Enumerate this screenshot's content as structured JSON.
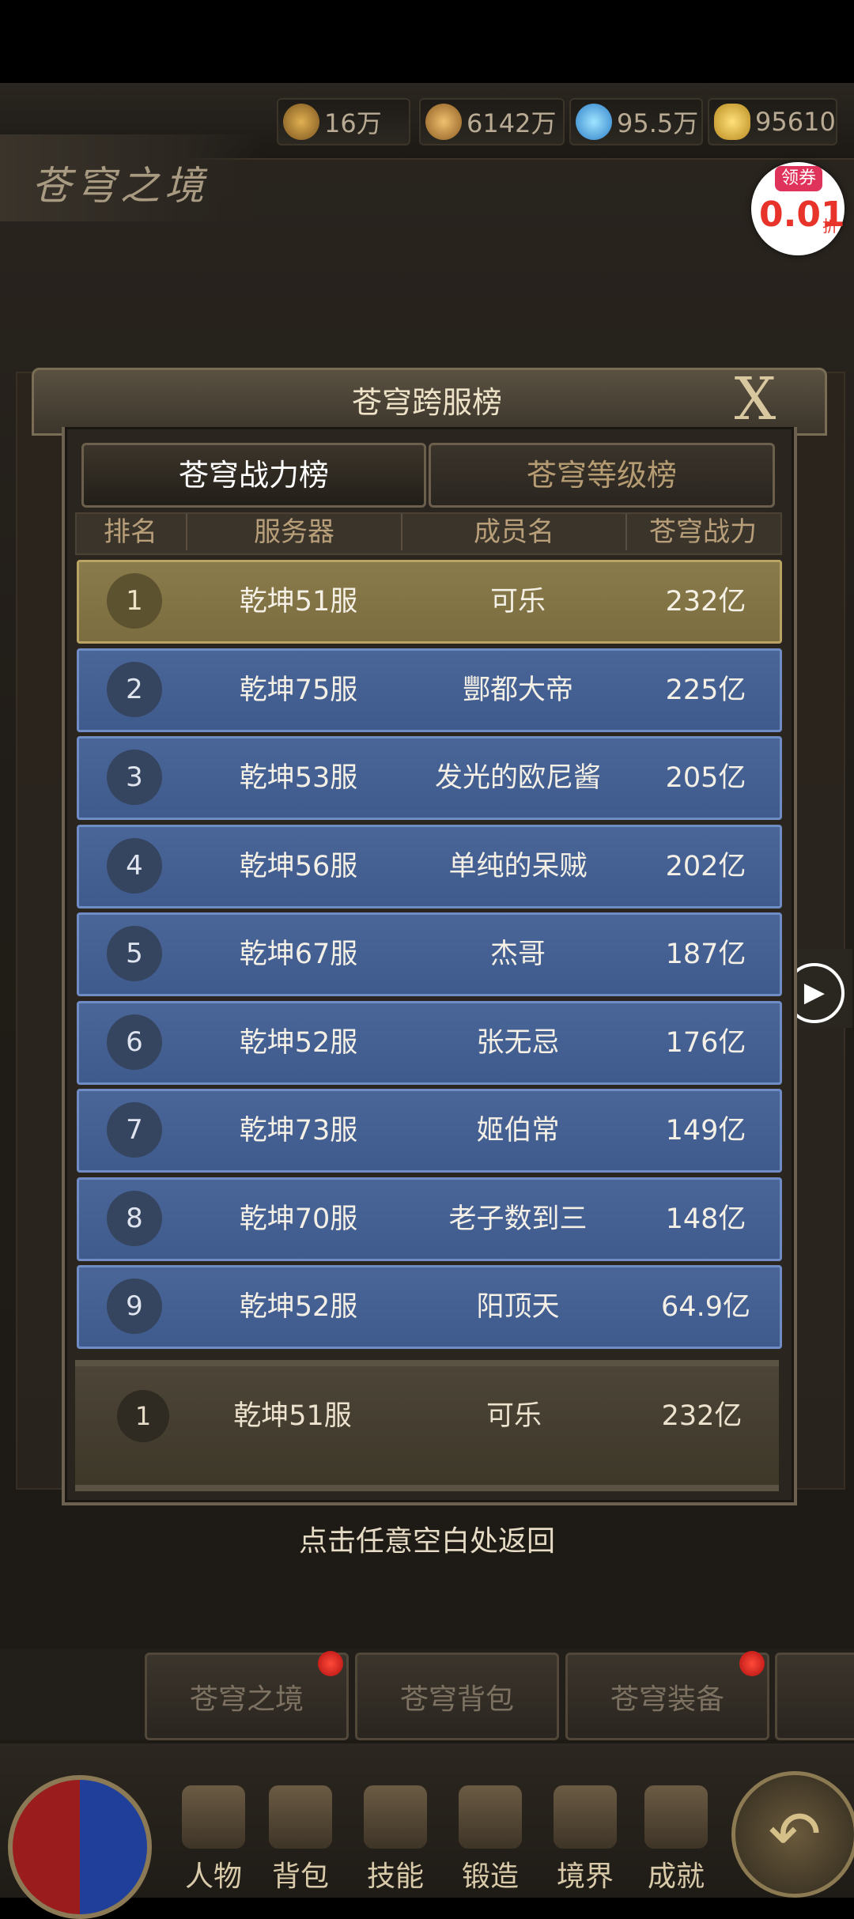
{
  "currencies": [
    {
      "icon": "gold-ore-icon",
      "value": "16万"
    },
    {
      "icon": "spiral-coin-icon",
      "value": "6142万"
    },
    {
      "icon": "diamond-icon",
      "value": "95.5万"
    },
    {
      "icon": "gold-ingot-icon",
      "value": "95610"
    }
  ],
  "scene_title": "苍穹之境",
  "coupon": {
    "tag": "领券",
    "value": "0.01",
    "unit": "折"
  },
  "modal": {
    "title": "苍穹跨服榜",
    "tabs": [
      "苍穹战力榜",
      "苍穹等级榜"
    ],
    "active_tab": 0,
    "columns": [
      "排名",
      "服务器",
      "成员名",
      "苍穹战力"
    ],
    "rows": [
      {
        "rank": "1",
        "server": "乾坤51服",
        "name": "可乐",
        "power": "232亿"
      },
      {
        "rank": "2",
        "server": "乾坤75服",
        "name": "酆都大帝",
        "power": "225亿"
      },
      {
        "rank": "3",
        "server": "乾坤53服",
        "name": "发光的欧尼酱",
        "power": "205亿"
      },
      {
        "rank": "4",
        "server": "乾坤56服",
        "name": "单纯的呆贼",
        "power": "202亿"
      },
      {
        "rank": "5",
        "server": "乾坤67服",
        "name": "杰哥",
        "power": "187亿"
      },
      {
        "rank": "6",
        "server": "乾坤52服",
        "name": "张无忌",
        "power": "176亿"
      },
      {
        "rank": "7",
        "server": "乾坤73服",
        "name": "姬伯常",
        "power": "149亿"
      },
      {
        "rank": "8",
        "server": "乾坤70服",
        "name": "老子数到三",
        "power": "148亿"
      },
      {
        "rank": "9",
        "server": "乾坤52服",
        "name": "阳顶天",
        "power": "64.9亿"
      }
    ],
    "my_rank": {
      "rank": "1",
      "server": "乾坤51服",
      "name": "可乐",
      "power": "232亿"
    },
    "hint": "点击任意空白处返回"
  },
  "bottom_tabs": [
    "苍穹之境",
    "苍穹背包",
    "苍穹装备"
  ],
  "menu": [
    "人物",
    "背包",
    "技能",
    "锻造",
    "境界",
    "成就"
  ],
  "colors": {
    "row_gold": "#8a7b4c",
    "row_blue": "#4a6597",
    "accent_red": "#e7332a"
  }
}
